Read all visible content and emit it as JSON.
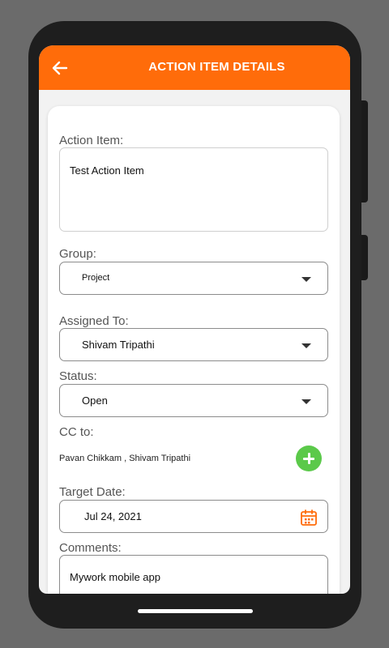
{
  "appbar": {
    "title": "ACTION ITEM DETAILS"
  },
  "form": {
    "action_item": {
      "label": "Action Item:",
      "value": "Test Action  Item"
    },
    "group": {
      "label": "Group:",
      "value": "Project"
    },
    "assigned_to": {
      "label": "Assigned To:",
      "value": "Shivam Tripathi"
    },
    "status": {
      "label": "Status:",
      "value": "Open"
    },
    "cc": {
      "label": "CC to:",
      "value": "Pavan Chikkam , Shivam Tripathi"
    },
    "target_date": {
      "label": "Target Date:",
      "value": "Jul 24, 2021"
    },
    "comments": {
      "label": "Comments:",
      "value": "Mywork mobile app"
    }
  },
  "colors": {
    "accent": "#ff6c0a",
    "add_button": "#5bc94a"
  },
  "icons": [
    "back-arrow-icon",
    "chevron-down-icon",
    "plus-icon",
    "calendar-icon"
  ]
}
